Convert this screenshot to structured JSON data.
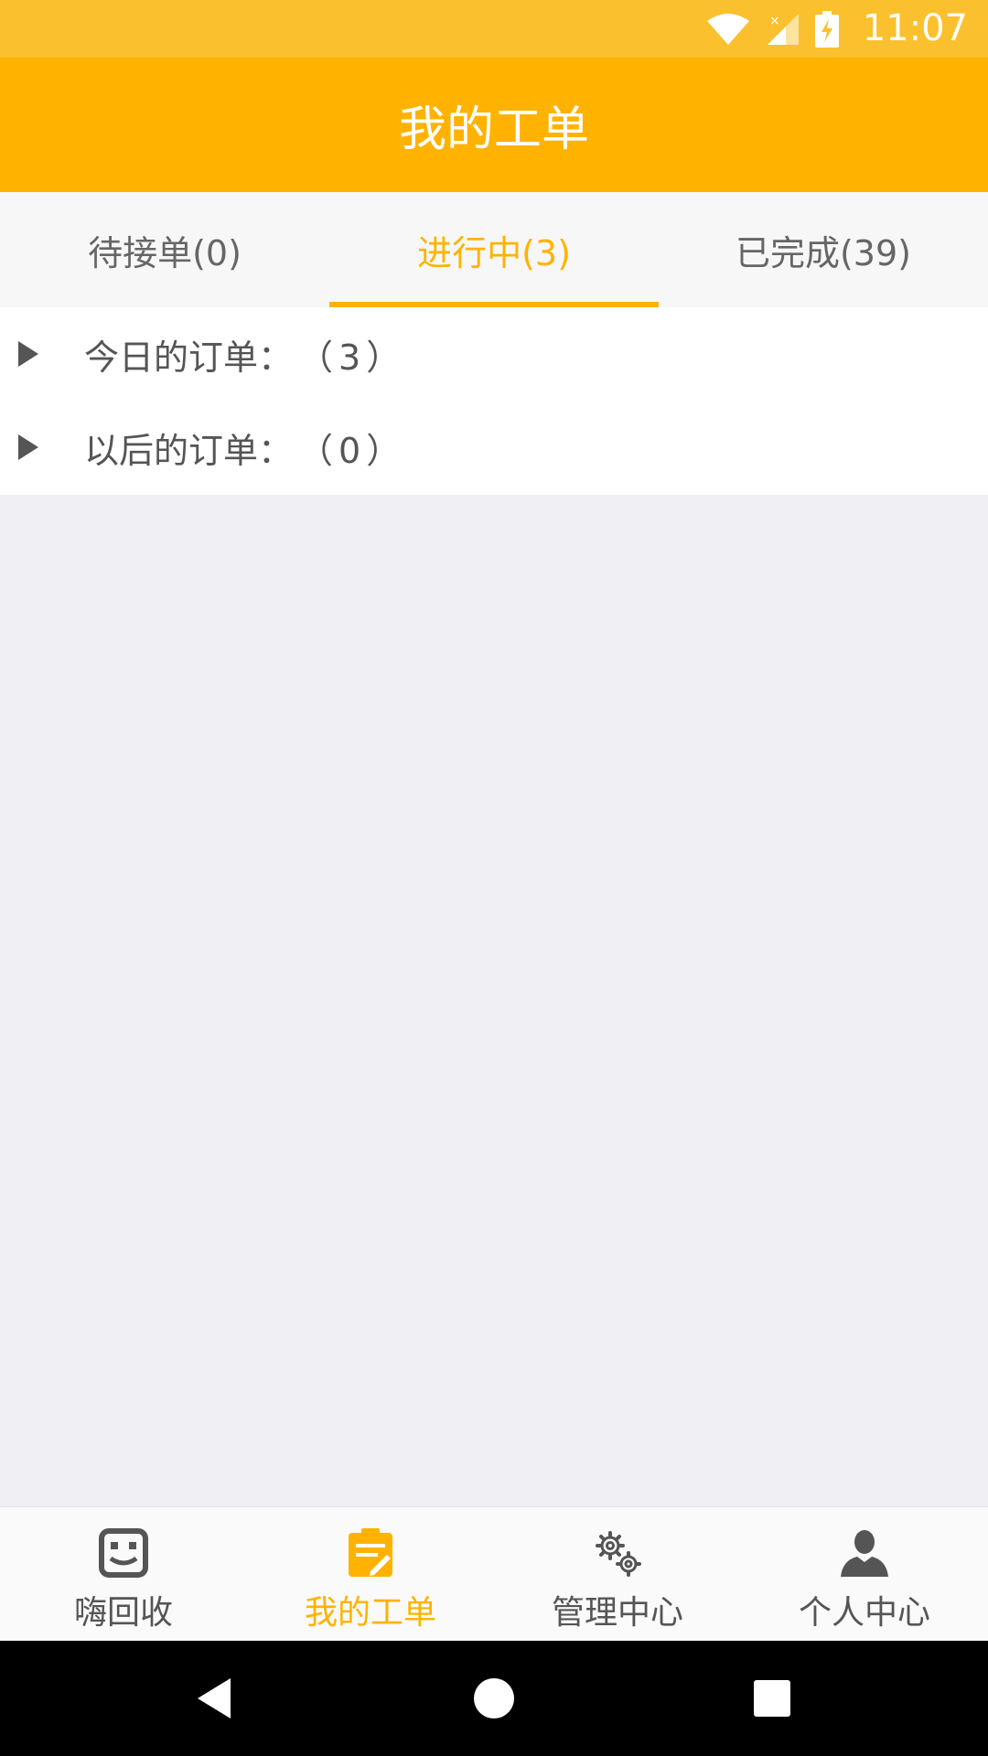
{
  "status_bar": {
    "time": "11:07",
    "icons": [
      "wifi-icon",
      "signal-icon",
      "battery-charging-icon"
    ]
  },
  "app_bar": {
    "title": "我的工单"
  },
  "tabs": [
    {
      "label": "待接单(0)",
      "active": false
    },
    {
      "label": "进行中(3)",
      "active": true
    },
    {
      "label": "已完成(39)",
      "active": false
    }
  ],
  "groups": [
    {
      "label": "今日的订单：",
      "count": "（3）"
    },
    {
      "label": "以后的订单：",
      "count": "（0）"
    }
  ],
  "bottom_nav": [
    {
      "label": "嗨回收",
      "icon": "recycle-box-icon",
      "active": false
    },
    {
      "label": "我的工单",
      "icon": "work-order-icon",
      "active": true
    },
    {
      "label": "管理中心",
      "icon": "gears-icon",
      "active": false
    },
    {
      "label": "个人中心",
      "icon": "person-icon",
      "active": false
    }
  ],
  "system_nav": [
    "back-icon",
    "home-icon",
    "recents-icon"
  ],
  "colors": {
    "accent": "#ffb300",
    "status_bar": "#fbc02d",
    "background": "#efeff4"
  }
}
